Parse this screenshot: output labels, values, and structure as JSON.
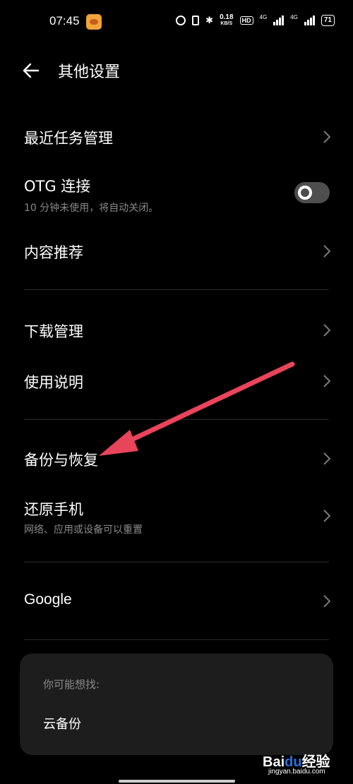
{
  "status": {
    "time": "07:45",
    "speed_value": "0.18",
    "speed_unit": "KB/S",
    "hd": "HD",
    "net1": "4G",
    "net2": "4G",
    "battery": "71"
  },
  "header": {
    "title": "其他设置"
  },
  "rows": [
    {
      "label": "最近任务管理"
    },
    {
      "label": "OTG 连接",
      "sub": "10 分钟未使用，将自动关闭。",
      "toggle_on": false
    },
    {
      "label": "内容推荐"
    },
    {
      "label": "下载管理"
    },
    {
      "label": "使用说明"
    },
    {
      "label": "备份与恢复"
    },
    {
      "label": "还原手机",
      "sub": "网络、应用或设备可以重置"
    },
    {
      "label": "Google"
    }
  ],
  "suggest": {
    "heading": "你可能想找:",
    "item": "云备份"
  },
  "watermark": {
    "logo_a": "Bai",
    "logo_du": "du",
    "logo_b": "经验",
    "url": "jingyan.baidu.com"
  },
  "colors": {
    "background": "#000000",
    "card": "#1d1d1d",
    "secondary_text": "#8a8a8a",
    "arrow": "#e8445a",
    "toggle_track": "#4e4e4e"
  }
}
